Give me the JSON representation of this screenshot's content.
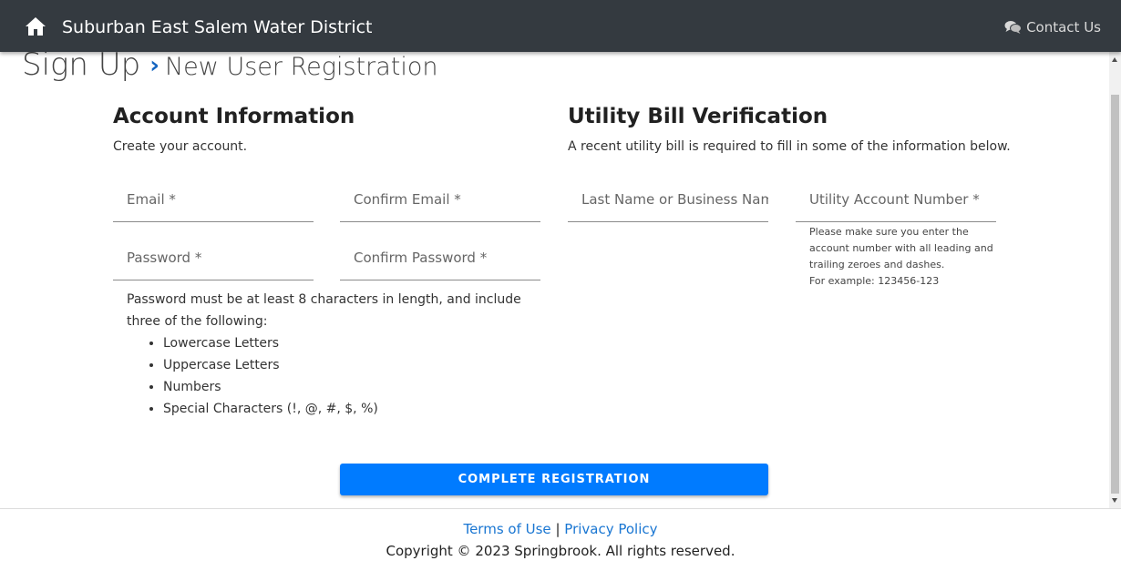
{
  "header": {
    "brand": "Suburban East Salem Water District",
    "contact_label": "Contact Us",
    "icons": {
      "home": "home-icon",
      "contact": "chat-bubbles-icon"
    }
  },
  "page": {
    "title": "Sign Up",
    "separator": "›",
    "subtitle": "New User Registration"
  },
  "account": {
    "title": "Account Information",
    "description": "Create your account.",
    "email_placeholder": "Email *",
    "confirm_email_placeholder": "Confirm Email *",
    "password_placeholder": "Password *",
    "confirm_password_placeholder": "Confirm Password *",
    "password_rules_intro": "Password must be at least 8 characters in length, and include three of the following:",
    "password_rules": [
      "Lowercase Letters",
      "Uppercase Letters",
      "Numbers",
      "Special Characters (!, @, #, $, %)"
    ]
  },
  "verification": {
    "title": "Utility Bill Verification",
    "description": "A recent utility bill is required to fill in some of the information below.",
    "last_name_placeholder": "Last Name or Business Name",
    "account_number_placeholder": "Utility Account Number *",
    "help_text": "Please make sure you enter the account number with all leading and trailing zeroes and dashes.",
    "example_text": "For example: 123456-123"
  },
  "actions": {
    "submit_label": "COMPLETE REGISTRATION"
  },
  "footer": {
    "terms_label": "Terms of Use",
    "divider": "|",
    "privacy_label": "Privacy Policy",
    "copyright": "Copyright © 2023 Springbrook. All rights reserved."
  },
  "colors": {
    "navbar": "#343a40",
    "primary": "#007bff",
    "link": "#1976d2"
  }
}
